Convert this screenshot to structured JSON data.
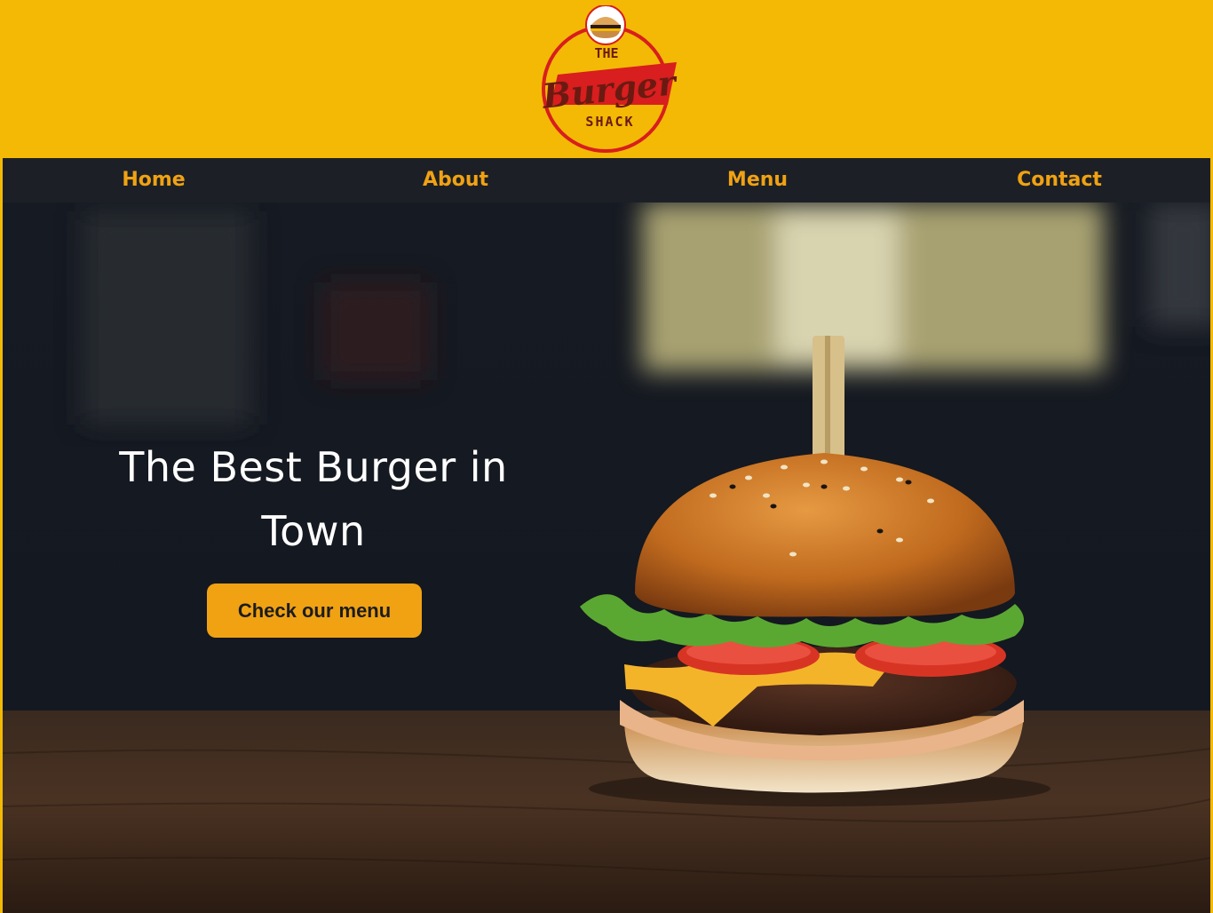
{
  "brand": {
    "logo_top": "THE",
    "logo_main": "Burger",
    "logo_bottom": "SHACK"
  },
  "nav": {
    "items": [
      {
        "label": "Home"
      },
      {
        "label": "About"
      },
      {
        "label": "Menu"
      },
      {
        "label": "Contact"
      }
    ]
  },
  "hero": {
    "title_line1": "The Best Burger in",
    "title_line2": "Town",
    "cta_label": "Check our menu",
    "image": "burger-photo"
  },
  "colors": {
    "header_bg": "#f3b905",
    "nav_bg": "#1c2026",
    "nav_text": "#f0a213",
    "cta_bg": "#f0a213",
    "logo_red": "#d81e1e",
    "logo_brown": "#6b1a12"
  }
}
